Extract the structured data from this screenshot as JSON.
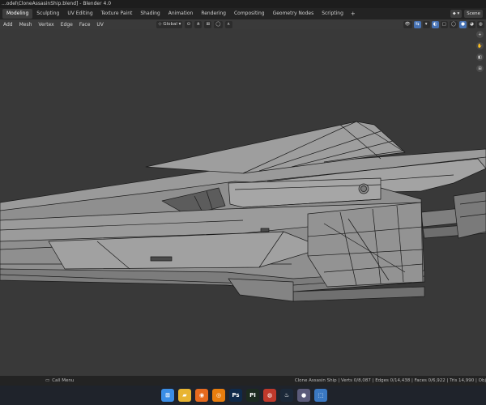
{
  "window": {
    "title": "...odel\\CloneAssasinShip.blend] - Blender 4.0"
  },
  "workspaces": {
    "tabs": [
      "Modeling",
      "Sculpting",
      "UV Editing",
      "Texture Paint",
      "Shading",
      "Animation",
      "Rendering",
      "Compositing",
      "Geometry Nodes",
      "Scripting"
    ],
    "active": "Modeling",
    "add_label": "+"
  },
  "scene": {
    "label": "Scene"
  },
  "viewport_header": {
    "menus": [
      "Add",
      "Mesh",
      "Vertex",
      "Edge",
      "Face",
      "UV"
    ],
    "transform_orientation": "Global"
  },
  "status_bar": {
    "left_text": "Call Menu",
    "right_text": "Clone Assasin Ship | Verts 0/8,087 | Edges 0/14,438 | Faces 0/6,922 | Tris 14,990 | Obj"
  },
  "colors": {
    "viewport_bg": "#393939",
    "mesh_fill": "#8d8d8d",
    "wire": "#1a1a1a",
    "accent_blue": "#4772b3"
  },
  "taskbar": {
    "icons": [
      {
        "name": "windows-start-icon",
        "glyph": "⊞",
        "color": "#3b8ee6"
      },
      {
        "name": "file-explorer-icon",
        "glyph": "▰",
        "color": "#e8b431"
      },
      {
        "name": "firefox-icon",
        "glyph": "◉",
        "color": "#e66a1e"
      },
      {
        "name": "blender-icon",
        "glyph": "◎",
        "color": "#e87d0d"
      },
      {
        "name": "photoshop-icon",
        "glyph": "Ps",
        "color": "#0f2a4a"
      },
      {
        "name": "pycharm-icon",
        "glyph": "PI",
        "color": "#1c2b1f"
      },
      {
        "name": "davinci-icon",
        "glyph": "◍",
        "color": "#c0392b"
      },
      {
        "name": "steam-icon",
        "glyph": "♨",
        "color": "#1b2838"
      },
      {
        "name": "obs-icon",
        "glyph": "●",
        "color": "#5b5b7a"
      },
      {
        "name": "app-icon",
        "glyph": "⬚",
        "color": "#3a78c2"
      }
    ]
  }
}
